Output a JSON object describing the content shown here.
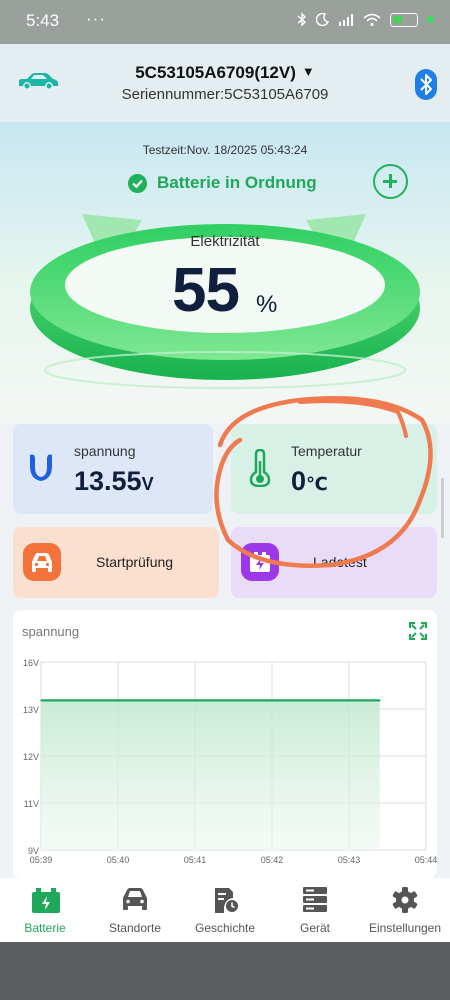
{
  "status_bar": {
    "time": "5:43",
    "dots": "···",
    "icons": [
      "bluetooth-icon",
      "moon-icon",
      "lte-signal-icon",
      "wifi-icon",
      "battery-icon",
      "green-dot-icon"
    ]
  },
  "header": {
    "device_name": "5C53105A6709(12V)",
    "serial": "Seriennummer:5C53105A6709",
    "icons": [
      "car-icon",
      "chevron-down-icon",
      "bluetooth-icon"
    ]
  },
  "hero": {
    "testzeit": "Testzeit:Nov. 18/2025 05:43:24",
    "status": "Batterie in Ordnung",
    "label": "Elektrizität",
    "value": "55",
    "unit": "%",
    "level_percent": 55,
    "colors": {
      "status": "#1fa75a",
      "ring": "#22c35c"
    }
  },
  "cards": {
    "voltage": {
      "title": "spannung",
      "value": "13.55",
      "unit": "V",
      "icon": "voltage-icon"
    },
    "temperature": {
      "title": "Temperatur",
      "value": "0",
      "unit": "℃",
      "icon": "thermometer-icon"
    },
    "start_test": {
      "label": "Startprüfung",
      "icon": "car-icon"
    },
    "charge_test": {
      "label": "Ladetest",
      "icon": "charging-icon"
    }
  },
  "annotation": {
    "color": "#f07a4f"
  },
  "chart": {
    "title": "spannung",
    "icon": "fullscreen-icon"
  },
  "chart_data": {
    "type": "area",
    "title": "spannung",
    "xlabel": "",
    "ylabel": "",
    "y_ticks": [
      "16V",
      "13V",
      "12V",
      "11V",
      "9V"
    ],
    "x_ticks": [
      "05:39",
      "05:40",
      "05:41",
      "05:42",
      "05:43",
      "05:44"
    ],
    "x": [
      "05:39",
      "05:40",
      "05:41",
      "05:42",
      "05:43",
      "05:43:24"
    ],
    "values": [
      13.55,
      13.55,
      13.55,
      13.55,
      13.55,
      13.55
    ],
    "grid": true,
    "color": "#1fa75a"
  },
  "nav": {
    "items": [
      {
        "label": "Batterie",
        "icon": "battery-icon",
        "active": true
      },
      {
        "label": "Standorte",
        "icon": "car-icon",
        "active": false
      },
      {
        "label": "Geschichte",
        "icon": "history-icon",
        "active": false
      },
      {
        "label": "Gerät",
        "icon": "device-icon",
        "active": false
      },
      {
        "label": "Einstellungen",
        "icon": "gear-icon",
        "active": false
      }
    ]
  }
}
